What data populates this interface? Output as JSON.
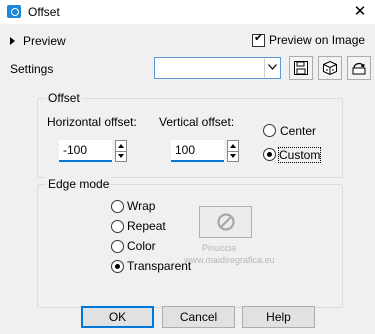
{
  "window": {
    "title": "Offset",
    "close_glyph": "✕",
    "app_icon": "paint-shop-icon"
  },
  "toolbar": {
    "preview_label": "Preview",
    "preview_on_image_label": "Preview on Image",
    "preview_on_image_checked": true,
    "settings_label": "Settings",
    "settings_value": "",
    "icons": [
      "save-preset-icon",
      "manage-presets-icon",
      "reset-defaults-icon"
    ]
  },
  "offset_group": {
    "title": "Offset",
    "horizontal_label": "Horizontal offset:",
    "horizontal_value": "-100",
    "vertical_label": "Vertical offset:",
    "vertical_value": "100",
    "center_label": "Center",
    "custom_label": "Custom",
    "selected": "Custom"
  },
  "edge_mode_group": {
    "title": "Edge mode",
    "options": [
      "Wrap",
      "Repeat",
      "Color",
      "Transparent"
    ],
    "selected": "Transparent"
  },
  "watermark": {
    "line1": "Pinuccia",
    "line2": "www.maidiregrafica.eu"
  },
  "buttons": {
    "ok": "OK",
    "cancel": "Cancel",
    "help": "Help"
  },
  "colors": {
    "accent": "#0078d7",
    "dialog_background": "#f0f0f0",
    "title_background": "#ffffff"
  }
}
